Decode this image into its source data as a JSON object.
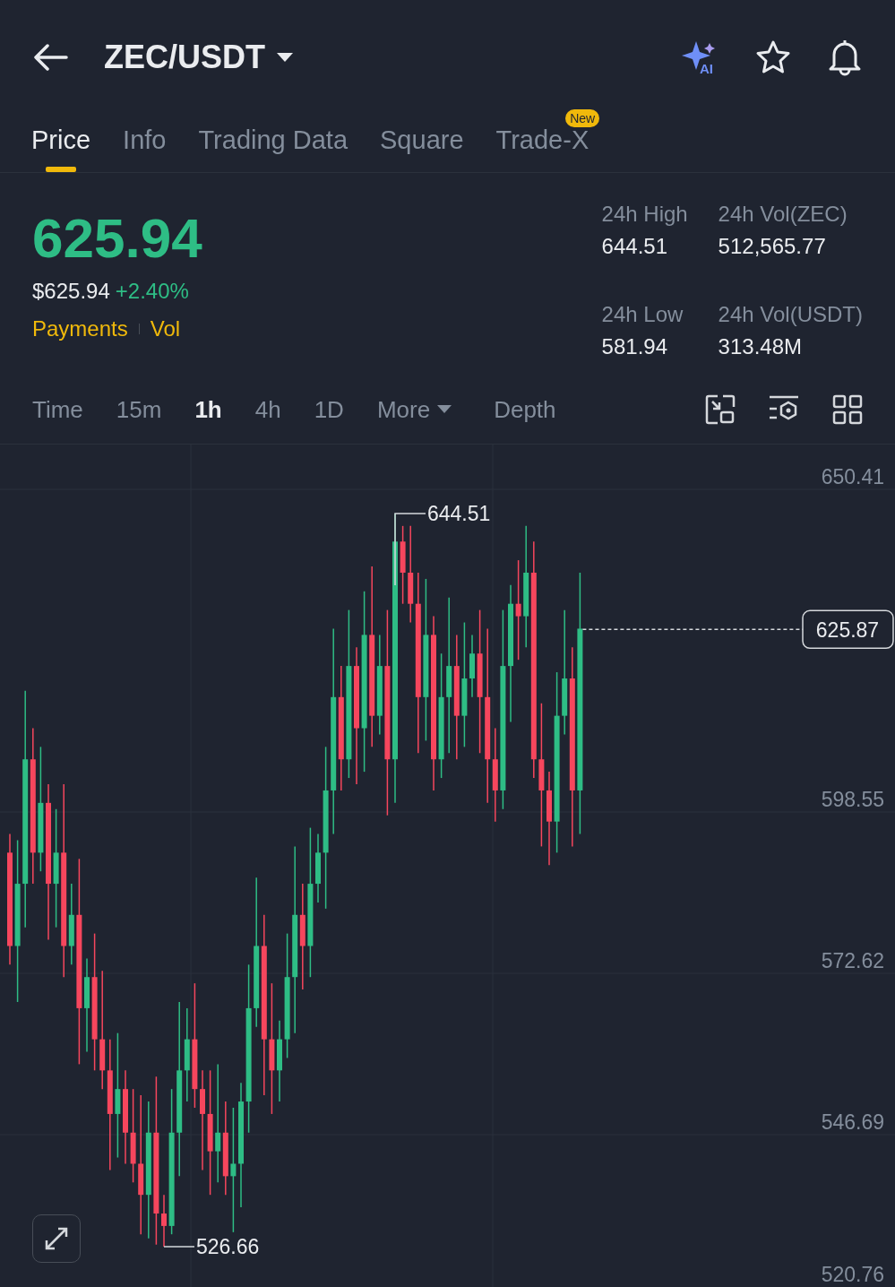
{
  "header": {
    "title": "ZEC/USDT",
    "ai_label": "AI"
  },
  "tabs": [
    {
      "label": "Price",
      "selected": true
    },
    {
      "label": "Info",
      "selected": false
    },
    {
      "label": "Trading Data",
      "selected": false
    },
    {
      "label": "Square",
      "selected": false
    },
    {
      "label": "Trade-X",
      "selected": false,
      "badge": "New"
    }
  ],
  "price": {
    "last": "625.94",
    "usd": "$625.94",
    "change": "+2.40%",
    "tags": [
      "Payments",
      "Vol"
    ]
  },
  "stats": [
    {
      "label": "24h High",
      "value": "644.51"
    },
    {
      "label": "24h Vol(ZEC)",
      "value": "512,565.77"
    },
    {
      "label": "24h Low",
      "value": "581.94"
    },
    {
      "label": "24h Vol(USDT)",
      "value": "313.48M"
    }
  ],
  "intervals": [
    {
      "label": "Time",
      "selected": false,
      "kind": "plain"
    },
    {
      "label": "15m",
      "selected": false,
      "kind": "plain"
    },
    {
      "label": "1h",
      "selected": true,
      "kind": "plain"
    },
    {
      "label": "4h",
      "selected": false,
      "kind": "plain"
    },
    {
      "label": "1D",
      "selected": false,
      "kind": "plain"
    },
    {
      "label": "More",
      "selected": false,
      "kind": "dropdown"
    },
    {
      "label": "Depth",
      "selected": false,
      "kind": "plain"
    }
  ],
  "chart": {
    "y_labels": [
      "650.41",
      "598.55",
      "572.62",
      "546.69",
      "520.76"
    ],
    "current_price": "625.87",
    "high_marker": "644.51",
    "low_marker": "526.66"
  }
}
